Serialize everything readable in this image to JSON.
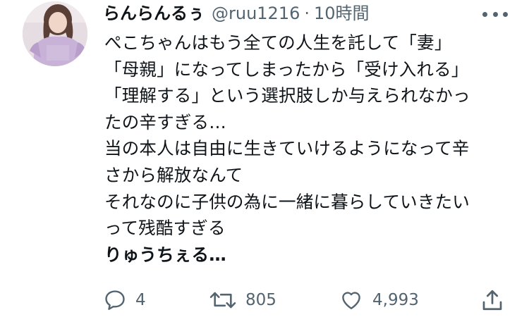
{
  "tweet": {
    "display_name": "らんらんるぅ",
    "handle": "@ruu1216",
    "separator": "·",
    "time": "10時間",
    "lines": [
      "ぺこちゃんはもう全ての人生を託して「妻」",
      "「母親」になってしまったから「受け入れる」",
      "「理解する」という選択肢しか与えられなかっ",
      "たの辛すぎる…",
      "当の本人は自由に生きていけるようになって辛",
      "さから解放なんて",
      "それなのに子供の為に一緒に暮らしていきたい",
      "って残酷すぎる"
    ],
    "bold_line": "りゅうちぇる…"
  },
  "actions": {
    "reply_count": "4",
    "retweet_count": "805",
    "like_count": "4,993"
  },
  "icons": {
    "avatar": "avatar-photo",
    "more": "more-dots-icon",
    "reply": "reply-bubble-icon",
    "retweet": "retweet-icon",
    "like": "heart-icon",
    "share": "share-upload-icon"
  },
  "colors": {
    "text": "#0f1419",
    "secondary": "#536471",
    "background": "#ffffff"
  }
}
